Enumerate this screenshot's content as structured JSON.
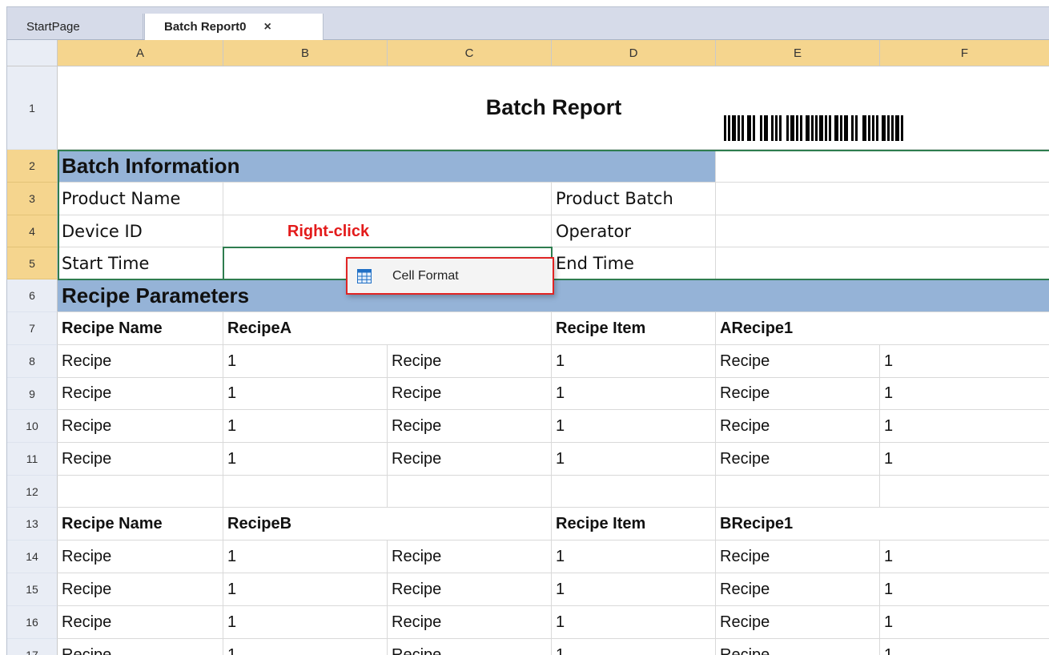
{
  "tabs": [
    {
      "label": "StartPage"
    },
    {
      "label": "Batch Report0",
      "close": "×"
    }
  ],
  "columns": [
    "A",
    "B",
    "C",
    "D",
    "E",
    "F"
  ],
  "rows": [
    "1",
    "2",
    "3",
    "4",
    "5",
    "6",
    "7",
    "8",
    "9",
    "10",
    "11",
    "12",
    "13",
    "14",
    "15",
    "16",
    "17"
  ],
  "report": {
    "title": "Batch Report",
    "section_batch": "Batch Information",
    "product_name": "Product Name",
    "product_batch": "Product Batch",
    "device_id": "Device ID",
    "operator": "Operator",
    "start_time": "Start Time",
    "end_time": "End Time",
    "section_recipe": "Recipe Parameters",
    "recipe_name_label": "Recipe Name",
    "recipe_item_label": "Recipe Item",
    "recipe_a": "RecipeA",
    "recipe_a_item": "ARecipe1",
    "recipe_b": "RecipeB",
    "recipe_b_item": "BRecipe1",
    "cell_recipe": "Recipe",
    "cell_one": "1"
  },
  "annotation": {
    "right_click": "Right-click"
  },
  "context_menu": {
    "items": [
      {
        "label": "Cell Format",
        "icon": "table-icon"
      }
    ]
  },
  "colors": {
    "header_yellow": "#f5d58e",
    "section_blue": "#95b3d7",
    "selection_green": "#2e7d4f",
    "annotation_red": "#e31b1b"
  }
}
